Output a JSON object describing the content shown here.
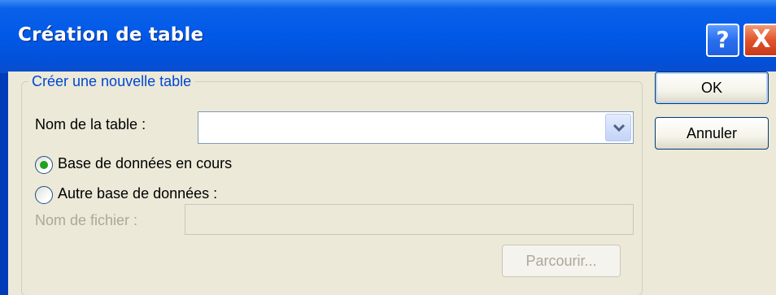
{
  "window": {
    "title": "Création de table"
  },
  "icons": {
    "help": "?",
    "close": "X"
  },
  "group": {
    "legend": "Créer une nouvelle table",
    "table_name_label": "Nom de la table :",
    "table_name_value": "",
    "radio_current_label": "Base de données en cours",
    "radio_other_label": "Autre base de données :",
    "selected_radio": "current",
    "file_name_label": "Nom de fichier :",
    "file_name_value": "",
    "browse_label": "Parcourir..."
  },
  "buttons": {
    "ok_label": "OK",
    "cancel_label": "Annuler"
  },
  "colors": {
    "titlebar": "#0058e6",
    "dialog_bg": "#ece9d8",
    "legend_text": "#0046d5",
    "radio_selected": "#21a121",
    "close_button": "#e2542a"
  }
}
